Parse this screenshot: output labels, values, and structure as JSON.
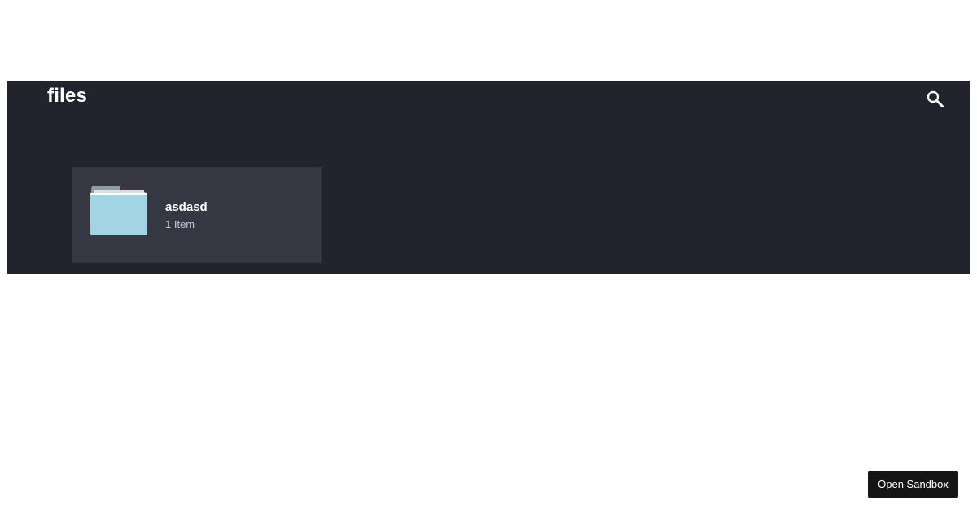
{
  "header": {
    "title": "files",
    "search_icon": "search-icon"
  },
  "folders": [
    {
      "icon": "folder-icon",
      "name": "asdasd",
      "count": "1 Item"
    }
  ],
  "footer": {
    "open_sandbox_label": "Open Sandbox"
  },
  "colors": {
    "page_background": "#ffffff",
    "panel_background": "#23232d",
    "card_background": "#373744",
    "folder_front": "#a2d4e3",
    "folder_tab": "#8e9da3",
    "button_background": "#151515"
  }
}
